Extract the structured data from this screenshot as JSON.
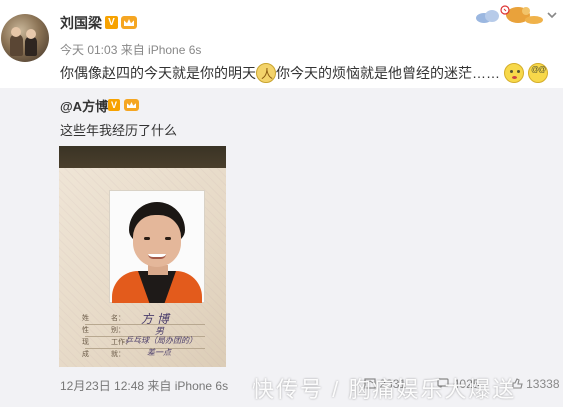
{
  "post": {
    "username": "刘国梁",
    "verified_badge": "V",
    "member_icon": "crown-icon",
    "meta": "今天 01:03 来自 iPhone 6s",
    "content_part1": "你偶像赵四的今天就是你的明天",
    "content_part2": "你今天的烦恼就是他曾经的迷茫……",
    "emojis": [
      "salute-icon",
      "pout-icon",
      "dizzy-icon"
    ]
  },
  "repost": {
    "username": "@A方博",
    "verified_badge": "V",
    "text": "这些年我经历了什么",
    "photo": {
      "field_labels": [
        "姓",
        "性",
        "现",
        "成"
      ],
      "field_labels_right": [
        "名：",
        "别：",
        "工作：",
        "就："
      ],
      "hand_name": "方 博",
      "hand_gender": "男",
      "hand_school": "乒乓球（局办团的）",
      "hand_grade": "差一点"
    },
    "meta": "12月23日 12:48 来自 iPhone 6s",
    "actions": {
      "repost_count": "2331",
      "comment_count": "4025",
      "like_count": "13338"
    }
  },
  "watermark": "快传号 / 胸痛娱乐大爆送",
  "colors": {
    "badge": "#f7a200",
    "repost_bg": "#f2f2f5",
    "jacket": "#e35b1c"
  }
}
